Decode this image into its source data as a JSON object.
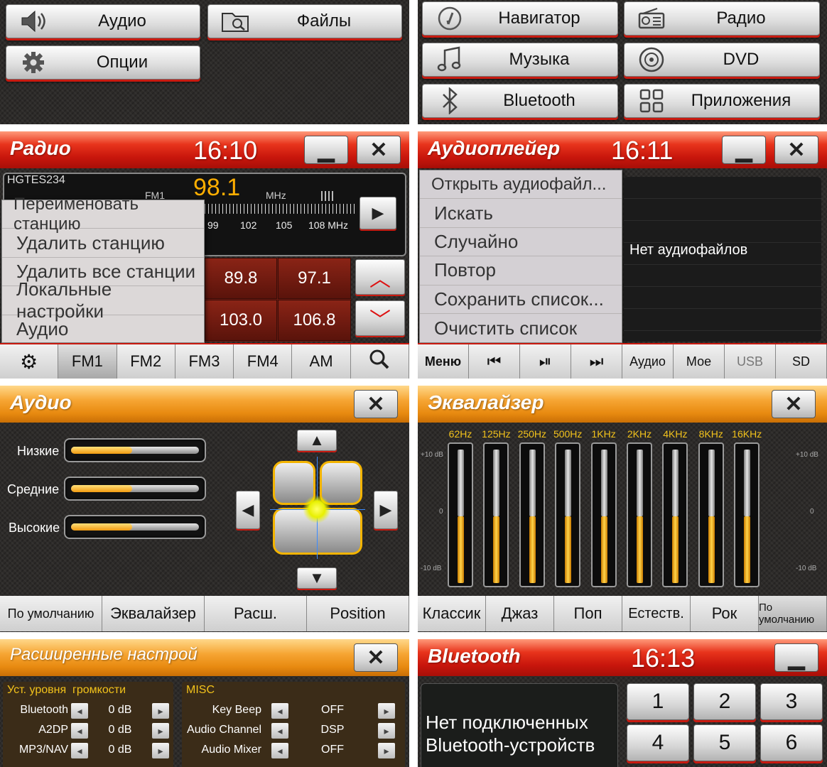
{
  "main_menu_left": {
    "items": [
      {
        "label": "Аудио",
        "icon": "speaker-icon"
      },
      {
        "label": "Файлы",
        "icon": "folder-icon"
      },
      {
        "label": "Опции",
        "icon": "gear-icon"
      }
    ]
  },
  "main_menu_right": {
    "items": [
      {
        "label": "Навигатор",
        "icon": "compass-icon"
      },
      {
        "label": "Радио",
        "icon": "radio-icon"
      },
      {
        "label": "Музыка",
        "icon": "music-note-icon"
      },
      {
        "label": "DVD",
        "icon": "disc-icon"
      },
      {
        "label": "Bluetooth",
        "icon": "bluetooth-icon"
      },
      {
        "label": "Приложения",
        "icon": "apps-grid-icon"
      }
    ]
  },
  "radio": {
    "title": "Радио",
    "time": "16:10",
    "station": "HGTES234",
    "band": "FM1",
    "frequency": "98.1",
    "unit": "MHz",
    "scale": [
      "99",
      "102",
      "105",
      "108 MHz"
    ],
    "presets": [
      "89.8",
      "97.1",
      "103.0",
      "106.8"
    ],
    "context_menu": [
      "Переименовать станцию",
      "Удалить станцию",
      "Удалить все станции",
      "Локальные настройки",
      "Аудио"
    ],
    "bands": [
      "FM1",
      "FM2",
      "FM3",
      "FM4",
      "AM"
    ],
    "active_band": "FM1"
  },
  "player": {
    "title": "Аудиоплейер",
    "time": "16:11",
    "menu": [
      "Открыть аудиофайл...",
      "Искать",
      "Случайно",
      "Повтор",
      "Сохранить список...",
      "Очистить список"
    ],
    "empty_text": "Нет аудиофайлов",
    "bottom": {
      "menu": "Меню",
      "audio": "Аудио",
      "mine": "Мое",
      "usb": "USB",
      "sd": "SD"
    }
  },
  "audio": {
    "title": "Аудио",
    "sliders": [
      {
        "label": "Низкие",
        "level": 0.48
      },
      {
        "label": "Средние",
        "level": 0.48
      },
      {
        "label": "Высокие",
        "level": 0.48
      }
    ],
    "tabs": [
      "По умолчанию",
      "Эквалайзер",
      "Расш.",
      "Position"
    ]
  },
  "eq": {
    "title": "Эквалайзер",
    "bands": [
      "62Hz",
      "125Hz",
      "250Hz",
      "500Hz",
      "1KHz",
      "2KHz",
      "4KHz",
      "8KHz",
      "16KHz"
    ],
    "levels_db": [
      0,
      0,
      0,
      0,
      0,
      0,
      0,
      0,
      0
    ],
    "scale": {
      "top": "+10 dB",
      "mid": "0",
      "bottom": "-10 dB"
    },
    "presets": [
      "Классик",
      "Джаз",
      "Поп",
      "Естеств.",
      "Рок",
      "По умолчанию"
    ],
    "active_preset": "По умолчанию"
  },
  "advanced": {
    "title": "Расширенные настрой",
    "left_header": "Уст. уровня  громкости",
    "left_rows": [
      {
        "name": "Bluetooth",
        "value": "0 dB"
      },
      {
        "name": "A2DP",
        "value": "0 dB"
      },
      {
        "name": "MP3/NAV",
        "value": "0 dB"
      }
    ],
    "right_header": "MISC",
    "right_rows": [
      {
        "name": "Key Beep",
        "value": "OFF"
      },
      {
        "name": "Audio Channel",
        "value": "DSP"
      },
      {
        "name": "Audio Mixer",
        "value": "OFF"
      }
    ]
  },
  "bluetooth": {
    "title": "Bluetooth",
    "time": "16:13",
    "status": "Нет подключенных Bluetooth-устройств",
    "keys": [
      "1",
      "2",
      "3",
      "4",
      "5",
      "6"
    ]
  },
  "colors": {
    "red_header": "#c8160c",
    "orange_header": "#e88a10",
    "accent_yellow": "#f6a533",
    "freq_orange": "#ffae00"
  }
}
